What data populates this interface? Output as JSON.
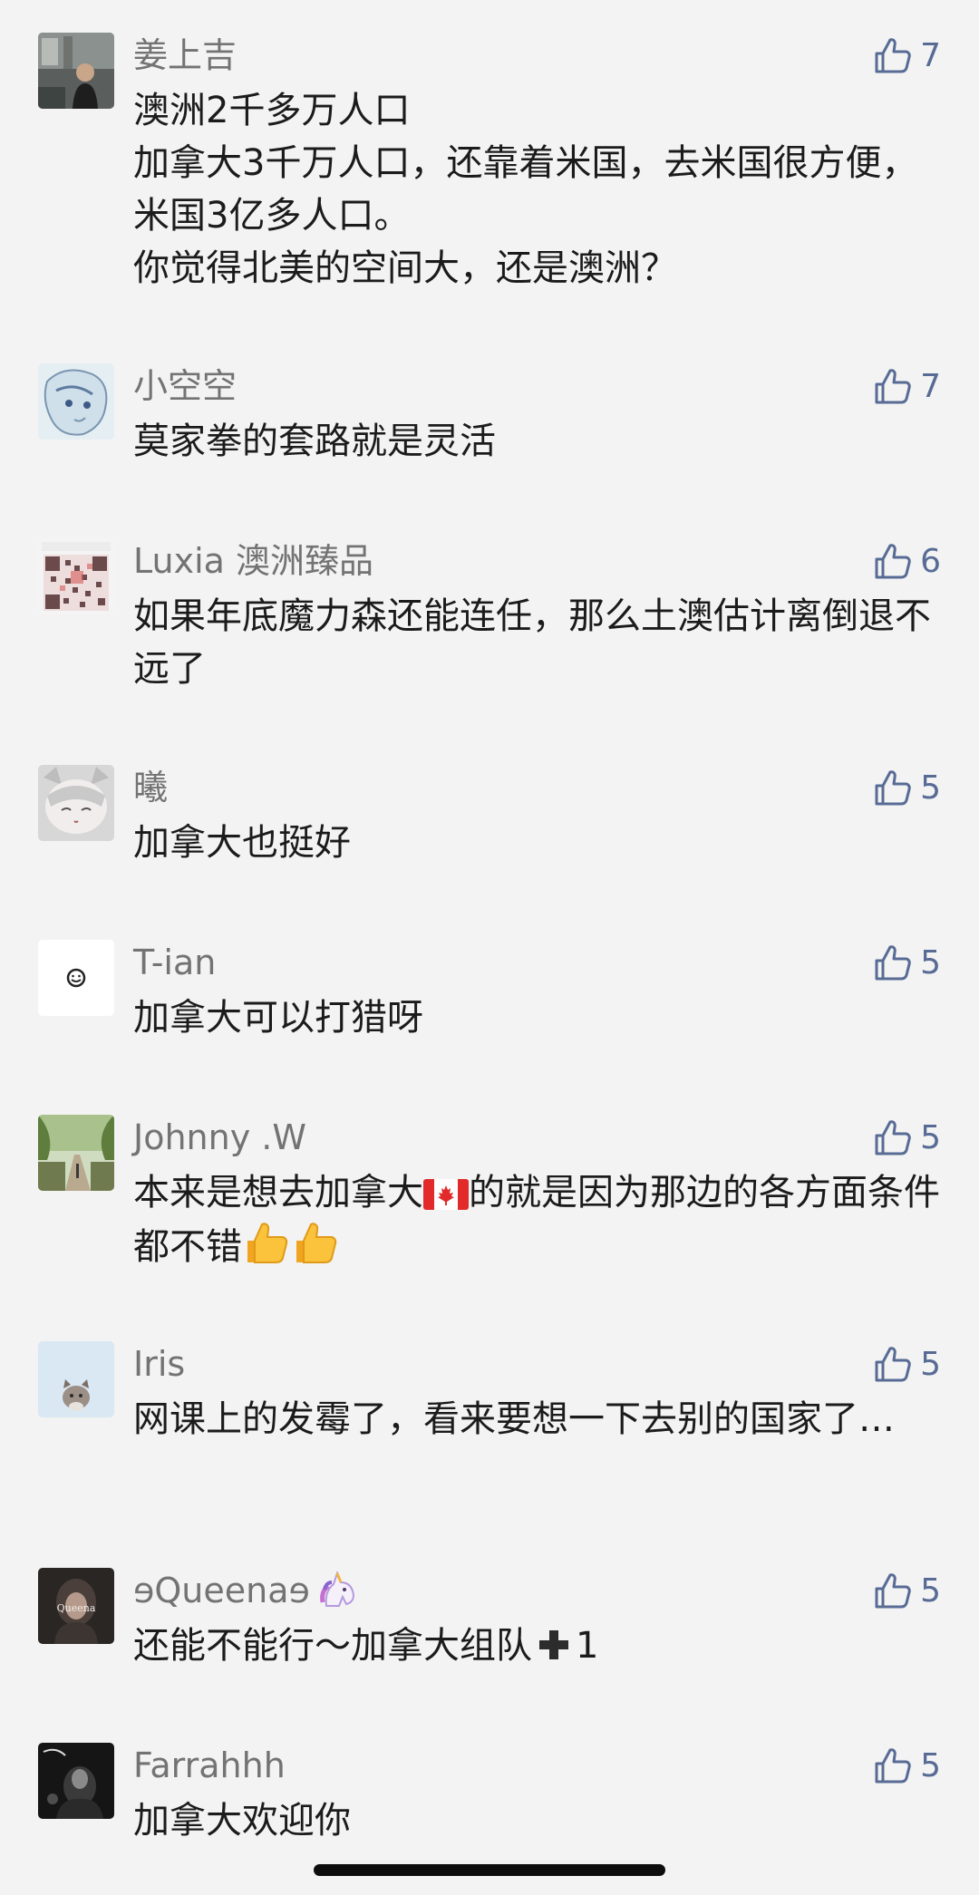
{
  "comments": [
    {
      "name": "姜上吉",
      "text": "澳洲2千多万人口\n加拿大3千万人口，还靠着米国，去米国很方便，米国3亿多人口。\n你觉得北美的空间大，还是澳洲？",
      "likes": "7",
      "avatar_icon": "avatar-photo-icon"
    },
    {
      "name": "小空空",
      "text": "莫家拳的套路就是灵活",
      "likes": "7",
      "avatar_icon": "avatar-anime-icon"
    },
    {
      "name": "Luxia 澳洲臻品",
      "text": "如果年底魔力森还能连任，那么土澳估计离倒退不远了",
      "likes": "6",
      "avatar_icon": "avatar-qrcode-icon"
    },
    {
      "name": "曦",
      "text": "加拿大也挺好",
      "likes": "5",
      "avatar_icon": "avatar-anime-cat-icon"
    },
    {
      "name": "T-ian",
      "text": "加拿大可以打猎呀",
      "likes": "5",
      "avatar_icon": "avatar-smiley-icon"
    },
    {
      "name": "Johnny .W",
      "text_before_flag": "本来是想去加拿大",
      "text_after_flag": "的就是因为那边的各方面条件都不错",
      "likes": "5",
      "avatar_icon": "avatar-street-icon",
      "flag_icon": "canada-flag-icon",
      "thumb_icon": "thumbs-up-emoji-icon"
    },
    {
      "name": "Iris",
      "text": "网课上的发霉了，看来要想一下去别的国家了…",
      "likes": "5",
      "avatar_icon": "avatar-cat-icon"
    },
    {
      "name": "ɘQueenaɘ",
      "text_before_plus": "还能不能行～加拿大组队",
      "text_after_plus": "1",
      "likes": "5",
      "avatar_icon": "avatar-queena-icon",
      "name_emoji": "unicorn-icon",
      "plus_icon": "plus-icon",
      "avatar_label": "Queena"
    },
    {
      "name": "Farrahhh",
      "text": "加拿大欢迎你",
      "likes": "5",
      "avatar_icon": "avatar-dark-photo-icon"
    }
  ],
  "colors": {
    "background": "#f3f3f3",
    "name": "#737373",
    "text": "#1b1b1b",
    "like": "#576b95"
  }
}
